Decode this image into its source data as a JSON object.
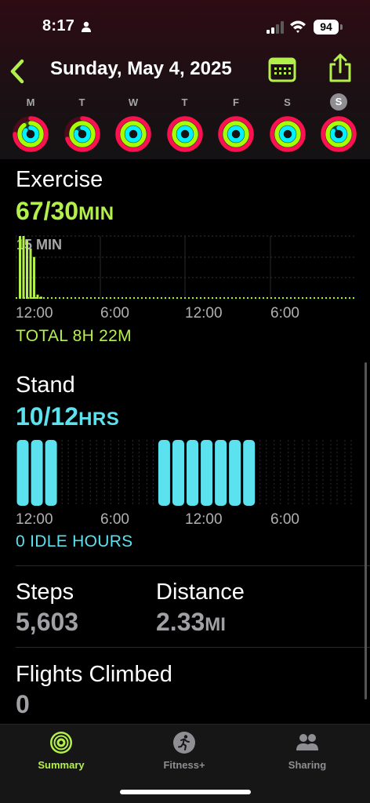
{
  "status_bar": {
    "time": "8:17",
    "battery": "94"
  },
  "nav": {
    "title": "Sunday, May 4, 2025"
  },
  "week": {
    "days": [
      {
        "letter": "M",
        "move": 0.75,
        "exercise": 0.9,
        "stand": 0.85,
        "selected": false
      },
      {
        "letter": "T",
        "move": 0.7,
        "exercise": 1.0,
        "stand": 0.8,
        "selected": false
      },
      {
        "letter": "W",
        "move": 1.0,
        "exercise": 1.0,
        "stand": 1.0,
        "selected": false
      },
      {
        "letter": "T",
        "move": 1.0,
        "exercise": 1.0,
        "stand": 1.0,
        "selected": false
      },
      {
        "letter": "F",
        "move": 1.0,
        "exercise": 1.0,
        "stand": 1.0,
        "selected": false
      },
      {
        "letter": "S",
        "move": 1.0,
        "exercise": 1.0,
        "stand": 1.0,
        "selected": false
      },
      {
        "letter": "S",
        "move": 1.0,
        "exercise": 1.0,
        "stand": 0.83,
        "selected": true
      }
    ]
  },
  "colors": {
    "move": "#fa114f",
    "exercise": "#a6ff00",
    "stand": "#00f0ff",
    "exercise_text": "#b4f04b",
    "stand_text": "#5ce1ee"
  },
  "exercise": {
    "title": "Exercise",
    "value": "67/30",
    "unit": "MIN",
    "scale_label": "15 MIN",
    "axis": [
      "12:00",
      "6:00",
      "12:00",
      "6:00"
    ],
    "total": "TOTAL 8H 22M",
    "chart_data": {
      "type": "bar",
      "unit": "min",
      "values": [
        15,
        15,
        14,
        12,
        10,
        1,
        0.5
      ]
    }
  },
  "stand": {
    "title": "Stand",
    "value": "10/12",
    "unit": "HRS",
    "axis": [
      "12:00",
      "6:00",
      "12:00",
      "6:00"
    ],
    "idle": "0 IDLE HOURS",
    "chart_data": {
      "type": "bar",
      "hours": [
        "0",
        "1",
        "2",
        "3",
        "4",
        "5",
        "6",
        "7",
        "8",
        "9",
        "10",
        "11",
        "12",
        "13",
        "14",
        "15",
        "16",
        "17",
        "18",
        "19",
        "20",
        "21",
        "22",
        "23"
      ],
      "stood": [
        1,
        1,
        1,
        0,
        0,
        0,
        0,
        0,
        0,
        0,
        1,
        1,
        1,
        1,
        1,
        1,
        1,
        0,
        0,
        0,
        0,
        0,
        0,
        0
      ]
    }
  },
  "steps": {
    "label": "Steps",
    "value": "5,603"
  },
  "distance": {
    "label": "Distance",
    "value": "2.33",
    "unit": "MI"
  },
  "flights": {
    "label": "Flights Climbed",
    "value": "0"
  },
  "tabs": [
    {
      "label": "Summary",
      "icon": "activity-rings-icon",
      "active": true
    },
    {
      "label": "Fitness+",
      "icon": "running-figure-icon",
      "active": false
    },
    {
      "label": "Sharing",
      "icon": "people-icon",
      "active": false
    }
  ]
}
